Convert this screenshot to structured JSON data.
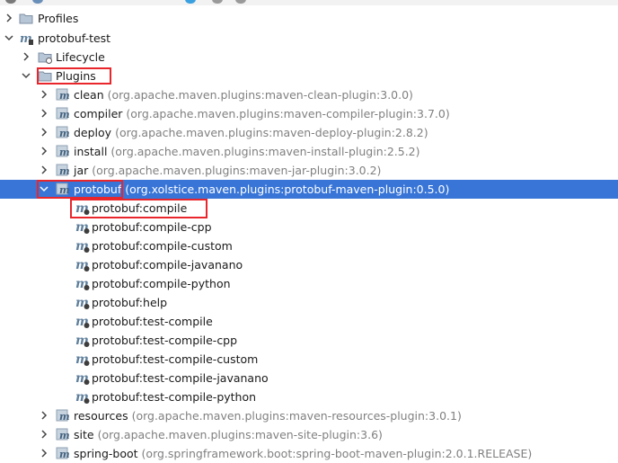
{
  "tree": {
    "profiles": {
      "label": "Profiles"
    },
    "project": {
      "label": "protobuf-test"
    },
    "lifecycle": {
      "label": "Lifecycle"
    },
    "plugins": {
      "label": "Plugins"
    },
    "plugin_list_top": [
      {
        "name": "clean",
        "coord": "(org.apache.maven.plugins:maven-clean-plugin:3.0.0)"
      },
      {
        "name": "compiler",
        "coord": "(org.apache.maven.plugins:maven-compiler-plugin:3.7.0)"
      },
      {
        "name": "deploy",
        "coord": "(org.apache.maven.plugins:maven-deploy-plugin:2.8.2)"
      },
      {
        "name": "install",
        "coord": "(org.apache.maven.plugins:maven-install-plugin:2.5.2)"
      },
      {
        "name": "jar",
        "coord": "(org.apache.maven.plugins:maven-jar-plugin:3.0.2)"
      }
    ],
    "protobuf_plugin": {
      "name": "protobuf",
      "coord": "(org.xolstice.maven.plugins:protobuf-maven-plugin:0.5.0)"
    },
    "goals": [
      "protobuf:compile",
      "protobuf:compile-cpp",
      "protobuf:compile-custom",
      "protobuf:compile-javanano",
      "protobuf:compile-python",
      "protobuf:help",
      "protobuf:test-compile",
      "protobuf:test-compile-cpp",
      "protobuf:test-compile-custom",
      "protobuf:test-compile-javanano",
      "protobuf:test-compile-python"
    ],
    "plugin_list_bottom": [
      {
        "name": "resources",
        "coord": "(org.apache.maven.plugins:maven-resources-plugin:3.0.1)"
      },
      {
        "name": "site",
        "coord": "(org.apache.maven.plugins:maven-site-plugin:3.6)"
      },
      {
        "name": "spring-boot",
        "coord": "(org.springframework.boot:spring-boot-maven-plugin:2.0.1.RELEASE)"
      }
    ]
  },
  "colors": {
    "selection": "#3875d7",
    "highlight_box": "#e8262b",
    "coordinate_text": "#808080"
  }
}
